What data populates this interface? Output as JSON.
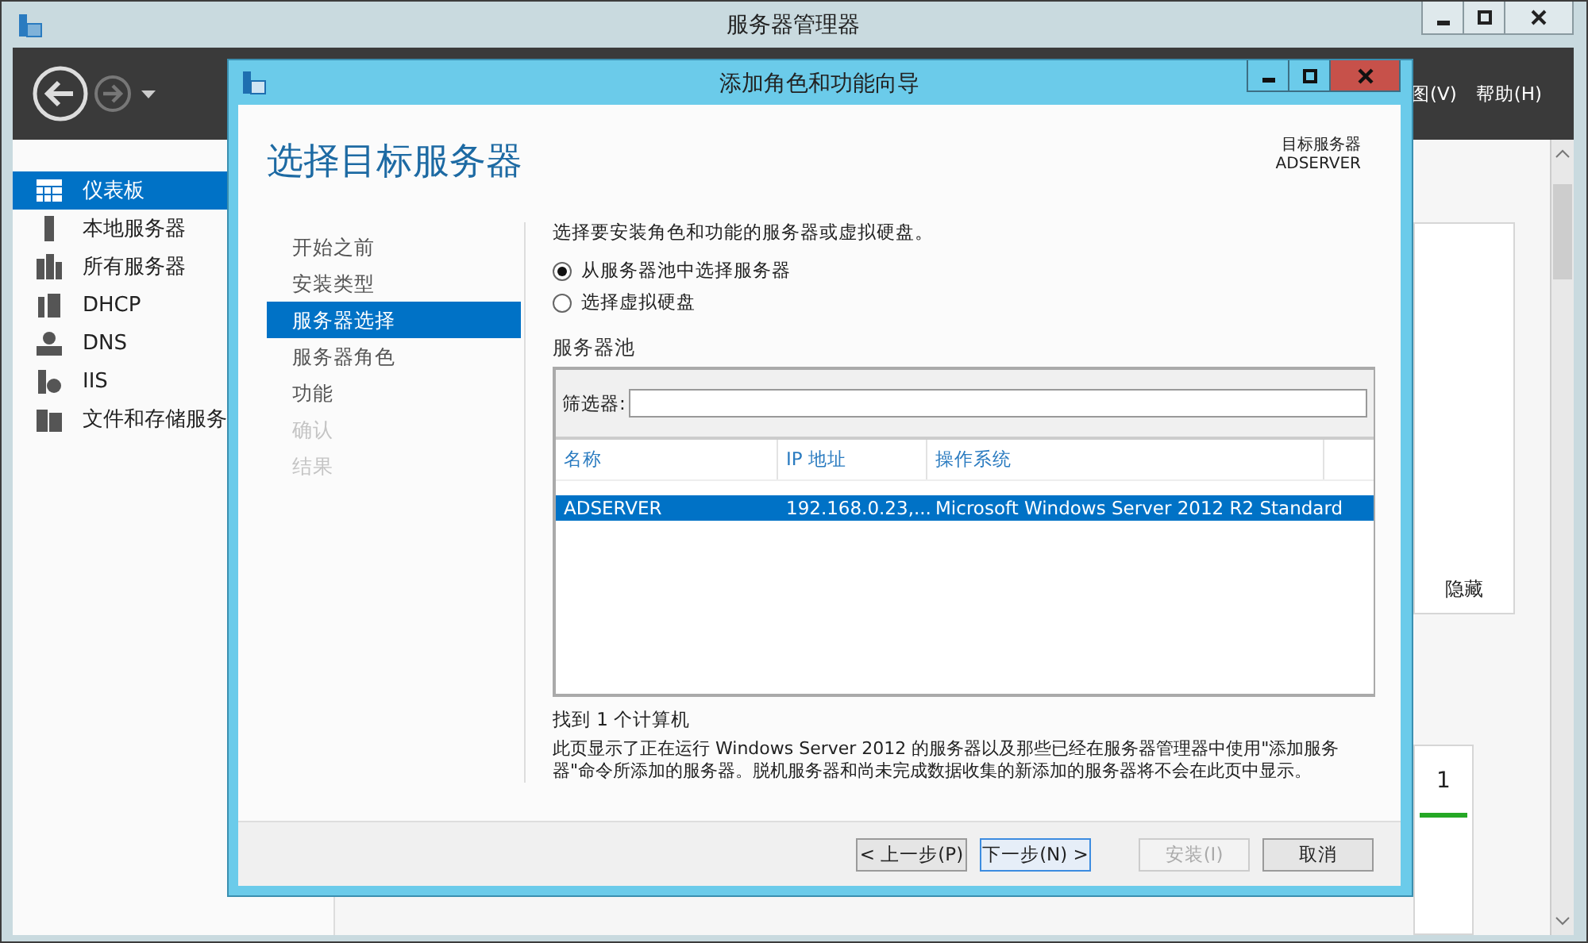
{
  "window": {
    "title": "服务器管理器"
  },
  "menu": [
    {
      "label": "图(V)"
    },
    {
      "label": "帮助(H)"
    }
  ],
  "sidebar": {
    "items": [
      {
        "label": "仪表板",
        "selected": true
      },
      {
        "label": "本地服务器",
        "selected": false
      },
      {
        "label": "所有服务器",
        "selected": false
      },
      {
        "label": "DHCP",
        "selected": false
      },
      {
        "label": "DNS",
        "selected": false
      },
      {
        "label": "IIS",
        "selected": false
      },
      {
        "label": "文件和存储服务",
        "selected": false
      }
    ]
  },
  "tiles": [
    {
      "text": "隐藏"
    },
    {
      "text": "1"
    }
  ],
  "dialog": {
    "title": "添加角色和功能向导",
    "heading": "选择目标服务器",
    "target_label": "目标服务器",
    "target_value": "ADSERVER",
    "steps": [
      {
        "label": "开始之前",
        "selected": false,
        "disabled": false
      },
      {
        "label": "安装类型",
        "selected": false,
        "disabled": false
      },
      {
        "label": "服务器选择",
        "selected": true,
        "disabled": false
      },
      {
        "label": "服务器角色",
        "selected": false,
        "disabled": false
      },
      {
        "label": "功能",
        "selected": false,
        "disabled": false
      },
      {
        "label": "确认",
        "selected": false,
        "disabled": true
      },
      {
        "label": "结果",
        "selected": false,
        "disabled": true
      }
    ],
    "description": "选择要安装角色和功能的服务器或虚拟硬盘。",
    "options": [
      {
        "label": "从服务器池中选择服务器",
        "selected": true
      },
      {
        "label": "选择虚拟硬盘",
        "selected": false
      }
    ],
    "pool": {
      "title": "服务器池",
      "filter_label": "筛选器:",
      "columns": [
        "名称",
        "IP 地址",
        "操作系统"
      ],
      "rows": [
        {
          "cells": [
            "ADSERVER",
            "192.168.0.23,...",
            "Microsoft Windows Server 2012 R2 Standard"
          ],
          "selected": true
        }
      ]
    },
    "count": "找到 1 个计算机",
    "note": "此页显示了正在运行 Windows Server 2012 的服务器以及那些已经在服务器管理器中使用\"添加服务器\"命令所添加的服务器。脱机服务器和尚未完成数据收集的新添加的服务器将不会在此页中显示。",
    "buttons": [
      {
        "label": "< 上一步(P)",
        "disabled": false,
        "focused": false
      },
      {
        "label": "下一步(N) >",
        "disabled": false,
        "focused": true
      },
      {
        "label": "安装(I)",
        "disabled": true,
        "focused": false
      },
      {
        "label": "取消",
        "disabled": false,
        "focused": false
      }
    ]
  }
}
